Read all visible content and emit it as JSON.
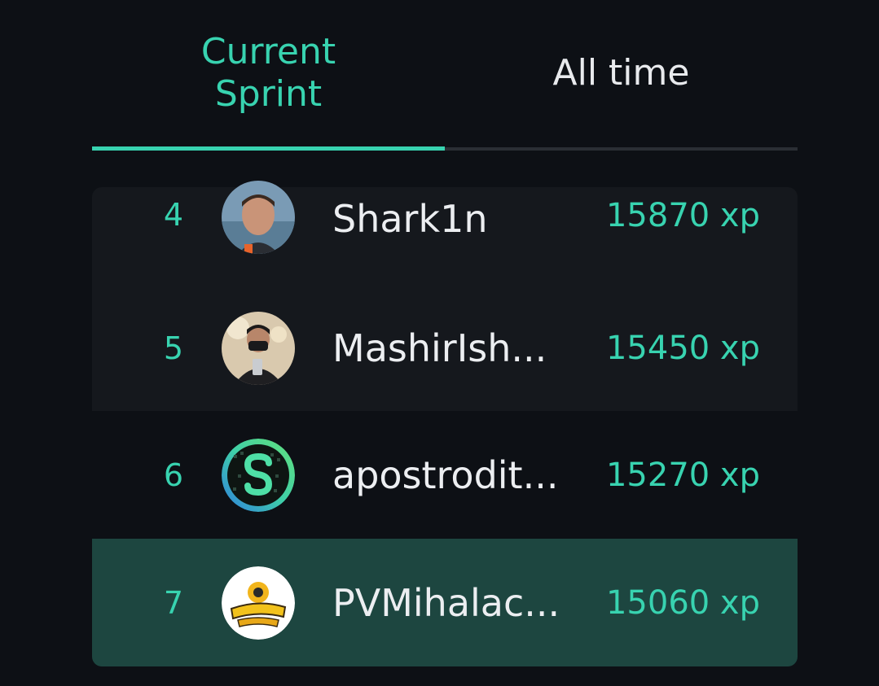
{
  "tabs": {
    "current_line1": "Current",
    "current_line2": "Sprint",
    "all_time": "All time"
  },
  "leaderboard": [
    {
      "rank": "4",
      "name": "Shark1n",
      "xp": "15870 xp",
      "avatar": "avatar-photo-man"
    },
    {
      "rank": "5",
      "name": "MashirIsh...",
      "xp": "15450 xp",
      "avatar": "avatar-photo-masked"
    },
    {
      "rank": "6",
      "name": "apostrodit...",
      "xp": "15270 xp",
      "avatar": "avatar-s-logo"
    },
    {
      "rank": "7",
      "name": "PVMihalac...",
      "xp": "15060 xp",
      "avatar": "avatar-humble-tractors-logo"
    }
  ],
  "colors": {
    "accent": "#38d3b0",
    "background": "#0d1015",
    "row_alt": "#15181d",
    "highlight_row": "#1d4640"
  }
}
